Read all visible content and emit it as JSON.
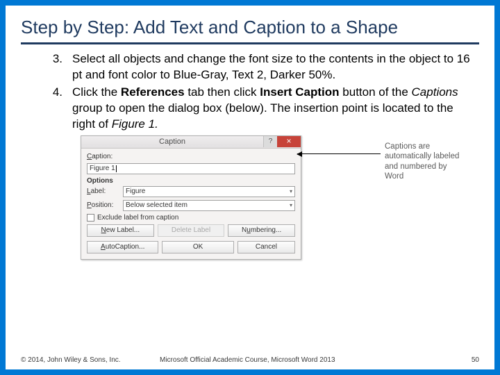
{
  "title": "Step by Step: Add Text and Caption to a Shape",
  "steps": [
    {
      "num": "3.",
      "parts": [
        {
          "t": "Select all objects and change the font size to the contents in the object to 16 pt and font color to Blue-Gray, Text 2, Darker 50%."
        }
      ]
    },
    {
      "num": "4.",
      "parts": [
        {
          "t": "Click the "
        },
        {
          "t": "References",
          "b": true
        },
        {
          "t": " tab then click "
        },
        {
          "t": "Insert Caption",
          "b": true
        },
        {
          "t": " button of the "
        },
        {
          "t": "Captions",
          "i": true
        },
        {
          "t": " group to open the dialog box (below). The insertion point is located to the right of "
        },
        {
          "t": "Figure 1.",
          "i": true
        }
      ]
    }
  ],
  "dialog": {
    "title": "Caption",
    "help": "?",
    "close": "×",
    "caption_label": "Caption:",
    "caption_value": "Figure 1",
    "options_label": "Options",
    "label_label": "Label:",
    "label_value": "Figure",
    "position_label": "Position:",
    "position_value": "Below selected item",
    "exclude_label": "Exclude label from caption",
    "btn_new": "New Label...",
    "btn_delete": "Delete Label",
    "btn_numbering": "Numbering...",
    "btn_auto": "AutoCaption...",
    "btn_ok": "OK",
    "btn_cancel": "Cancel"
  },
  "annotation": "Captions are automatically labeled and numbered by Word",
  "footer": {
    "left": "© 2014, John Wiley & Sons, Inc.",
    "center": "Microsoft Official Academic Course, Microsoft Word 2013",
    "right": "50"
  }
}
